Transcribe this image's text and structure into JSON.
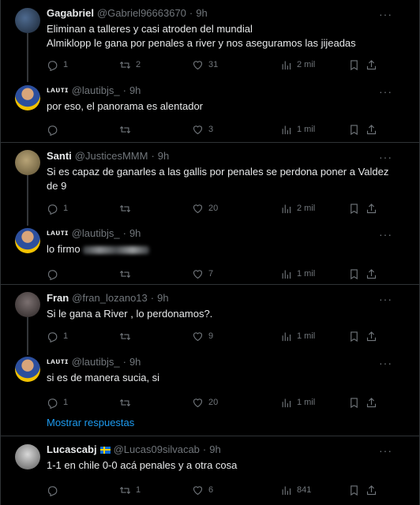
{
  "tweets": [
    {
      "name": "Gagabriel",
      "handle": "@Gabriel96663670",
      "time": "9h",
      "lines": [
        "Eliminan a talleres y casi atroden del mundial",
        "Almiklopp le gana por penales a river y nos aseguramos las jijeadas"
      ],
      "replies": "1",
      "retweets": "2",
      "likes": "31",
      "views": "2 mil"
    },
    {
      "name": "ʟᴀᴜᴛɪ",
      "handle": "@lautibjs_",
      "time": "9h",
      "lines": [
        "por eso, el panorama es alentador"
      ],
      "replies": "",
      "retweets": "",
      "likes": "3",
      "views": "1 mil"
    },
    {
      "name": "Santi",
      "handle": "@JusticesMMM",
      "time": "9h",
      "lines": [
        "Si es capaz de ganarles a las gallis por penales se perdona poner a Valdez",
        "de 9"
      ],
      "replies": "1",
      "retweets": "",
      "likes": "20",
      "views": "2 mil"
    },
    {
      "name": "ʟᴀᴜᴛɪ",
      "handle": "@lautibjs_",
      "time": "9h",
      "lines": [
        "lo firmo"
      ],
      "replies": "",
      "retweets": "",
      "likes": "7",
      "views": "1 mil"
    },
    {
      "name": "Fran",
      "handle": "@fran_lozano13",
      "time": "9h",
      "lines": [
        "Si le gana a River , lo perdonamos?."
      ],
      "replies": "1",
      "retweets": "",
      "likes": "9",
      "views": "1 mil"
    },
    {
      "name": "ʟᴀᴜᴛɪ",
      "handle": "@lautibjs_",
      "time": "9h",
      "lines": [
        "si es de manera sucia, si"
      ],
      "replies": "1",
      "retweets": "",
      "likes": "20",
      "views": "1 mil"
    },
    {
      "name": "Lucascabj",
      "handle": "@Lucas09silvacab",
      "time": "9h",
      "lines": [
        "1-1 en chile 0-0 acá penales y a otra cosa"
      ],
      "replies": "",
      "retweets": "1",
      "likes": "6",
      "views": "841"
    }
  ],
  "show_replies_label": "Mostrar respuestas",
  "dot": "·",
  "more": "···",
  "icons": [
    "reply-icon",
    "retweet-icon",
    "like-icon",
    "views-icon",
    "bookmark-icon",
    "share-icon"
  ],
  "colors": {
    "background": "#000000",
    "text": "#e7e9ea",
    "muted": "#71767b",
    "link": "#1d9bf0",
    "border": "#2f3336"
  }
}
